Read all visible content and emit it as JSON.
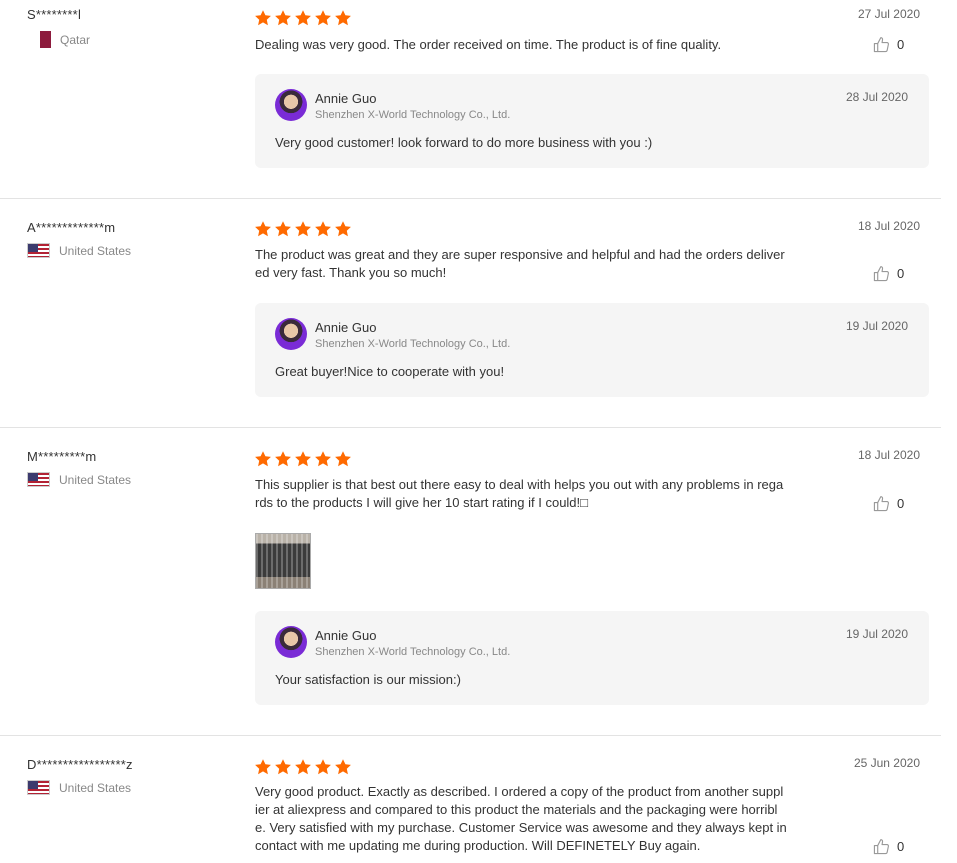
{
  "reviews": [
    {
      "buyer": "S********l",
      "country": "Qatar",
      "date": "27 Jul 2020",
      "text": "Dealing was very good. The order received on time. The product is of fine quality.",
      "likes": "0",
      "reply": {
        "name": "Annie Guo",
        "company": "Shenzhen X-World Technology Co., Ltd.",
        "date": "28 Jul 2020",
        "text": "Very good customer! look forward to do more business with you :)"
      }
    },
    {
      "buyer": "A*************m",
      "country": "United States",
      "date": "18 Jul 2020",
      "text_lines": [
        "The product was great and they are super responsive and helpful and had the orders deliver",
        "ed very fast. Thank you so much!"
      ],
      "likes": "0",
      "reply": {
        "name": "Annie Guo",
        "company": "Shenzhen X-World Technology Co., Ltd.",
        "date": "19 Jul 2020",
        "text": "Great buyer!Nice to cooperate with you!"
      }
    },
    {
      "buyer": "M*********m",
      "country": "United States",
      "date": "18 Jul 2020",
      "text_lines": [
        "This supplier is that best out there easy to deal with helps you out with any problems in rega",
        "rds to the products I will give her 10 start rating if I could!□"
      ],
      "likes": "0",
      "reply": {
        "name": "Annie Guo",
        "company": "Shenzhen X-World Technology Co., Ltd.",
        "date": "19 Jul 2020",
        "text": "Your satisfaction is our mission:)"
      }
    },
    {
      "buyer": "D*****************z",
      "country": "United States",
      "date": "25 Jun 2020",
      "text_lines": [
        "Very good product. Exactly as described. I ordered a copy of the product from another suppl",
        "ier at aliexpress and compared to this product the materials and the packaging were horribl",
        "e. Very satisfied with my purchase. Customer Service was awesome and they always kept in",
        "contact with me updating me during production. Will DEFINETELY Buy again."
      ],
      "likes": "0"
    }
  ],
  "rating": 5,
  "colors": {
    "star": "#ff6a00",
    "reply_bg": "#f5f5f5"
  },
  "icons": {
    "star": "star-icon",
    "like": "thumbs-up-icon"
  }
}
